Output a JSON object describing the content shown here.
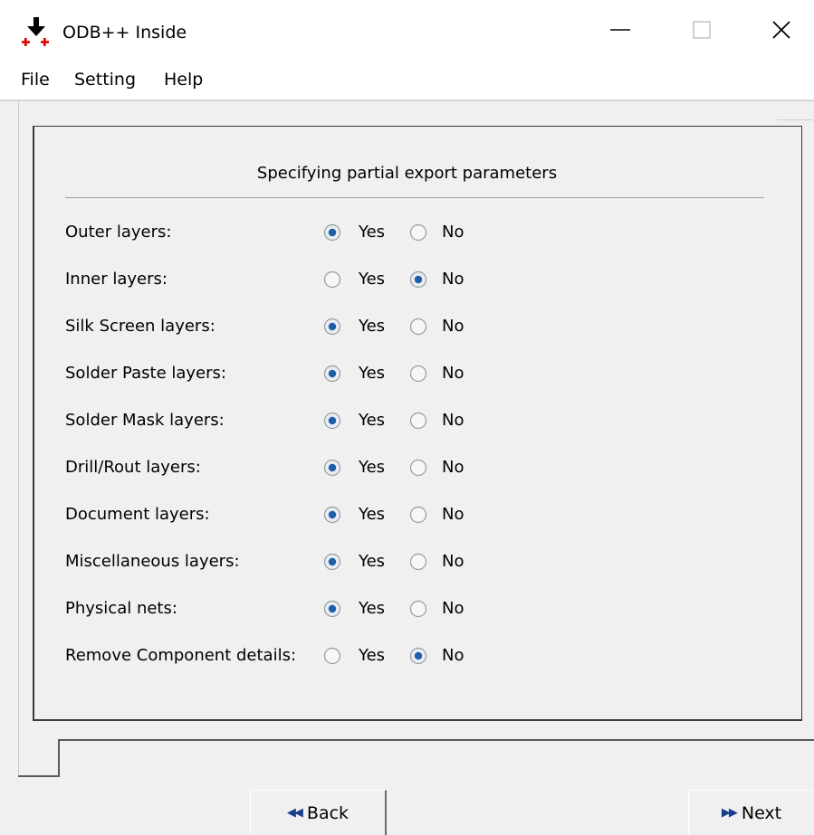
{
  "window": {
    "title": "ODB++ Inside",
    "icon": "download-arrow-plus-icon"
  },
  "menu": {
    "items": [
      "File",
      "Setting",
      "Help"
    ]
  },
  "panel": {
    "title": "Specifying partial export parameters",
    "yes_label": "Yes",
    "no_label": "No",
    "rows": [
      {
        "label": "Outer layers:",
        "selected": "Yes"
      },
      {
        "label": "Inner layers:",
        "selected": "No"
      },
      {
        "label": "Silk Screen layers:",
        "selected": "Yes"
      },
      {
        "label": "Solder Paste layers:",
        "selected": "Yes"
      },
      {
        "label": "Solder Mask layers:",
        "selected": "Yes"
      },
      {
        "label": "Drill/Rout layers:",
        "selected": "Yes"
      },
      {
        "label": "Document layers:",
        "selected": "Yes"
      },
      {
        "label": "Miscellaneous layers:",
        "selected": "Yes"
      },
      {
        "label": "Physical nets:",
        "selected": "Yes"
      },
      {
        "label": "Remove Component details:",
        "selected": "No"
      }
    ]
  },
  "buttons": {
    "back": "Back",
    "next": "Next"
  },
  "colors": {
    "radio_dot": "#1f5fa8",
    "nav_arrow": "#1a3e8f",
    "icon_red": "#e00000"
  }
}
